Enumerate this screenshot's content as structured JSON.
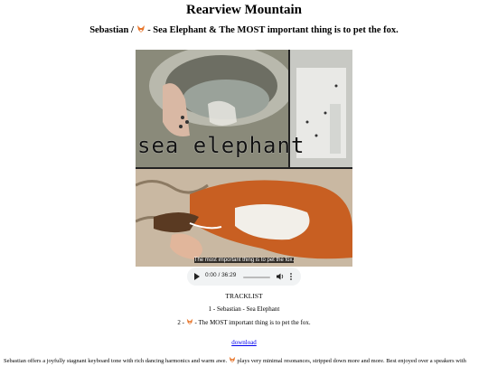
{
  "site": {
    "title": "Rearview Mountain"
  },
  "release": {
    "title_part1": "Sebastian / ",
    "title_part2": " - Sea Elephant & The MOST important thing is to pet the fox.",
    "cover_caption": "sea elephant",
    "cover_subtitle": "The most important thing is to pet the fox."
  },
  "player": {
    "time": "0:00 / 36:29",
    "progress": 0,
    "play_icon": "play-icon",
    "volume_icon": "volume-icon",
    "more_icon": "more-options-icon"
  },
  "tracklist": {
    "heading": "TRACKLIST",
    "items": [
      {
        "text_a": "1 - Sebastian - Sea Elephant",
        "text_b": ""
      },
      {
        "text_a": "2 - ",
        "text_b": " - The MOST important thing is to pet the fox."
      }
    ]
  },
  "download": {
    "label": "download"
  },
  "description": {
    "part1": "Sebastian offers a joyfully stagnant keyboard tone with rich dancing harmonics and warm awe. ",
    "part2": " plays very minimal resonances, stripped down more and more. Best enjoyed over a speakers with"
  },
  "colors": {
    "fox_orange": "#e8762b",
    "link": "#0000ee",
    "player_bg": "#f1f3f4"
  }
}
